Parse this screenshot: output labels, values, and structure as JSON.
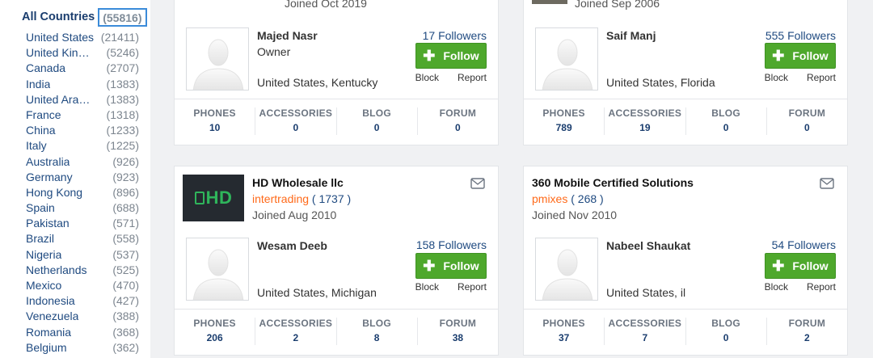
{
  "sidebar": {
    "all_label": "All Countries",
    "all_count": "(55816)",
    "countries": [
      {
        "name": "United States",
        "count": "(21411)"
      },
      {
        "name": "United Kin…",
        "count": "(5246)"
      },
      {
        "name": "Canada",
        "count": "(2707)"
      },
      {
        "name": "India",
        "count": "(1383)"
      },
      {
        "name": "United Ara…",
        "count": "(1383)"
      },
      {
        "name": "France",
        "count": "(1318)"
      },
      {
        "name": "China",
        "count": "(1233)"
      },
      {
        "name": "Italy",
        "count": "(1225)"
      },
      {
        "name": "Australia",
        "count": "(926)"
      },
      {
        "name": "Germany",
        "count": "(923)"
      },
      {
        "name": "Hong Kong",
        "count": "(896)"
      },
      {
        "name": "Spain",
        "count": "(688)"
      },
      {
        "name": "Pakistan",
        "count": "(571)"
      },
      {
        "name": "Brazil",
        "count": "(558)"
      },
      {
        "name": "Nigeria",
        "count": "(537)"
      },
      {
        "name": "Netherlands",
        "count": "(525)"
      },
      {
        "name": "Mexico",
        "count": "(470)"
      },
      {
        "name": "Indonesia",
        "count": "(427)"
      },
      {
        "name": "Venezuela",
        "count": "(388)"
      },
      {
        "name": "Romania",
        "count": "(368)"
      },
      {
        "name": "Belgium",
        "count": "(362)"
      }
    ]
  },
  "cards": [
    {
      "joined": "Joined Oct 2019",
      "person": {
        "name": "Majed Nasr",
        "role": "Owner",
        "location": "United States, Kentucky"
      },
      "followers": "17 Followers",
      "follow_label": "Follow",
      "block_label": "Block",
      "report_label": "Report",
      "stats": [
        {
          "label": "PHONES",
          "value": "10"
        },
        {
          "label": "ACCESSORIES",
          "value": "0"
        },
        {
          "label": "BLOG",
          "value": "0"
        },
        {
          "label": "FORUM",
          "value": "0"
        }
      ]
    },
    {
      "joined": "Joined Sep 2006",
      "person": {
        "name": "Saif Manj",
        "location": "United States, Florida"
      },
      "followers": "555 Followers",
      "follow_label": "Follow",
      "block_label": "Block",
      "report_label": "Report",
      "stats": [
        {
          "label": "PHONES",
          "value": "789"
        },
        {
          "label": "ACCESSORIES",
          "value": "19"
        },
        {
          "label": "BLOG",
          "value": "0"
        },
        {
          "label": "FORUM",
          "value": "0"
        }
      ]
    },
    {
      "title": "HD Wholesale llc",
      "logo_text": "HD",
      "username": "intertrading",
      "rating": " ( 1737 )",
      "joined": "Joined Aug 2010",
      "person": {
        "name": "Wesam Deeb",
        "location": "United States, Michigan"
      },
      "followers": "158 Followers",
      "follow_label": "Follow",
      "block_label": "Block",
      "report_label": "Report",
      "stats": [
        {
          "label": "PHONES",
          "value": "206"
        },
        {
          "label": "ACCESSORIES",
          "value": "2"
        },
        {
          "label": "BLOG",
          "value": "8"
        },
        {
          "label": "FORUM",
          "value": "38"
        }
      ]
    },
    {
      "title": "360 Mobile Certified Solutions",
      "username": "pmixes",
      "rating": " ( 268 )",
      "joined": "Joined Nov 2010",
      "person": {
        "name": "Nabeel Shaukat",
        "location": "United States, il"
      },
      "followers": "54 Followers",
      "follow_label": "Follow",
      "block_label": "Block",
      "report_label": "Report",
      "stats": [
        {
          "label": "PHONES",
          "value": "37"
        },
        {
          "label": "ACCESSORIES",
          "value": "7"
        },
        {
          "label": "BLOG",
          "value": "0"
        },
        {
          "label": "FORUM",
          "value": "2"
        }
      ]
    }
  ]
}
